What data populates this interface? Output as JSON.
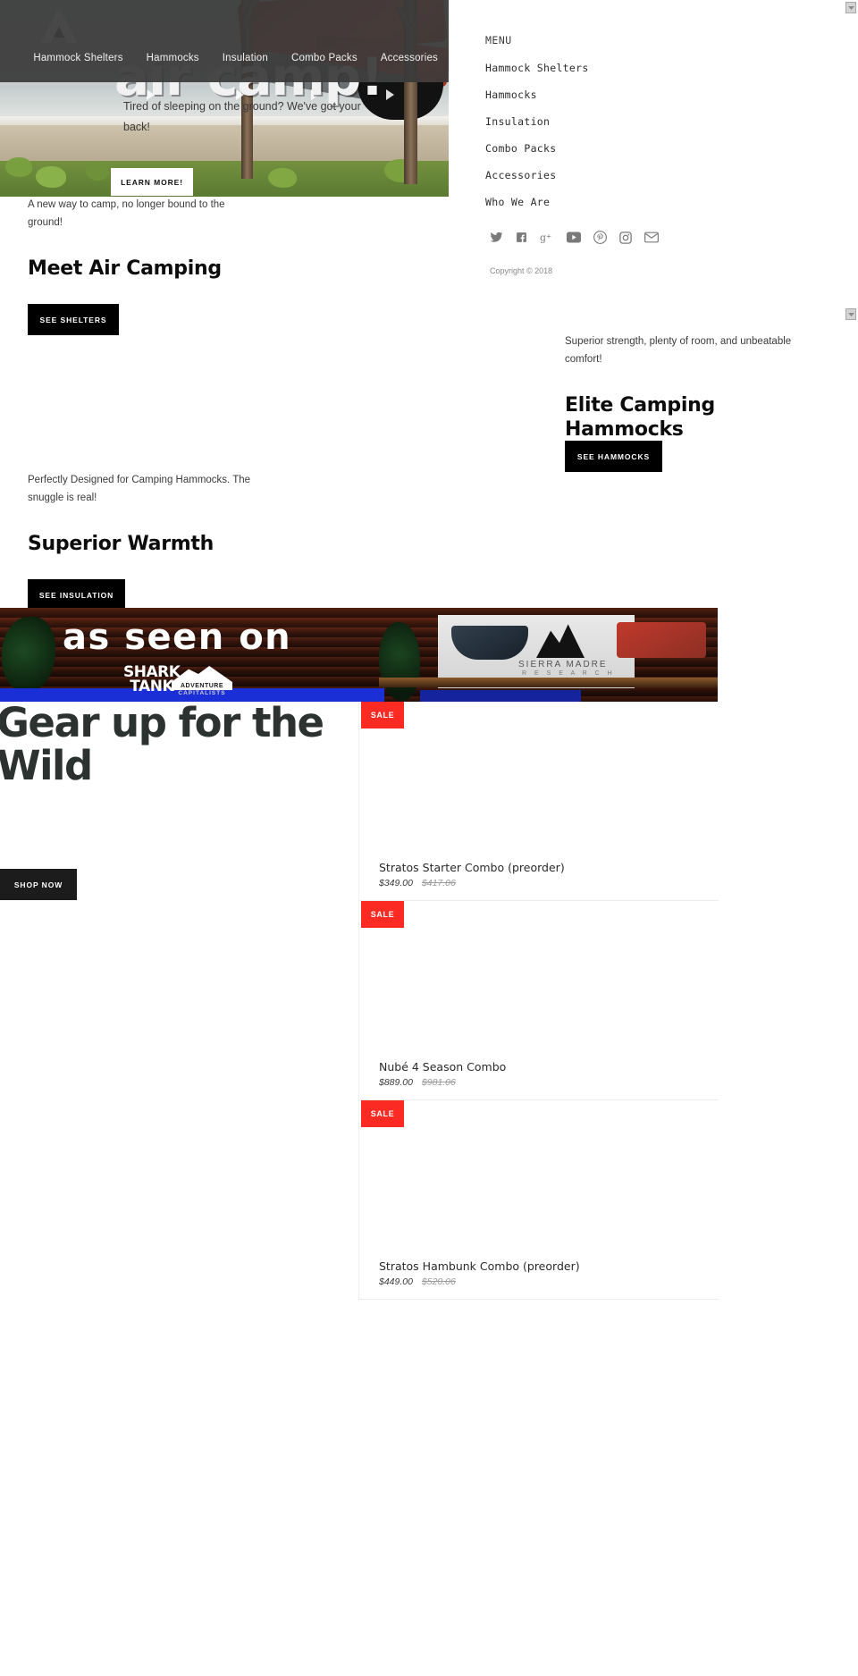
{
  "site": {
    "logo_icon": "mountain-logo-icon",
    "nav": [
      {
        "label": "Hammock Shelters"
      },
      {
        "label": "Hammocks"
      },
      {
        "label": "Insulation"
      },
      {
        "label": "Combo Packs"
      },
      {
        "label": "Accessories"
      }
    ]
  },
  "hero": {
    "title": "air camp!",
    "subtitle": "Tired of sleeping on the ground? We've got your back!",
    "cta": "LEARN MORE!"
  },
  "menu": {
    "heading": "MENU",
    "items": [
      {
        "label": "Hammock Shelters"
      },
      {
        "label": "Hammocks"
      },
      {
        "label": "Insulation"
      },
      {
        "label": "Combo Packs"
      },
      {
        "label": "Accessories"
      },
      {
        "label": "Who We Are"
      }
    ],
    "socials": [
      {
        "name": "twitter-icon"
      },
      {
        "name": "facebook-icon"
      },
      {
        "name": "google-plus-icon"
      },
      {
        "name": "youtube-icon"
      },
      {
        "name": "pinterest-icon"
      },
      {
        "name": "instagram-icon"
      },
      {
        "name": "email-icon"
      }
    ],
    "copyright": "Copyright © 2018"
  },
  "blocks": [
    {
      "blurb": "A new way to camp, no longer bound to the ground!",
      "title": "Meet Air Camping",
      "cta": "SEE SHELTERS"
    },
    {
      "blurb": "Superior strength, plenty of room, and unbeatable comfort!",
      "title": "Elite Camping Hammocks",
      "cta": "SEE HAMMOCKS"
    },
    {
      "blurb": "Perfectly Designed for Camping Hammocks. The snuggle is real!",
      "title": "Superior Warmth",
      "cta": "SEE INSULATION"
    }
  ],
  "banner": {
    "title": "as seen on",
    "shark_line1": "SHARK",
    "shark_line2": "TANK",
    "badge_line1": "ADVENTURE",
    "badge_line2": "CAPITALISTS",
    "sign_line1": "SIERRA MADRE",
    "sign_line2": "R E S E A R C H"
  },
  "gear": {
    "title": "Gear up for the Wild",
    "cta": "SHOP NOW"
  },
  "products": [
    {
      "badge": "SALE",
      "name": "Stratos Starter Combo (preorder)",
      "price": "$349.00",
      "old_price": "$417.06"
    },
    {
      "badge": "SALE",
      "name": "Nubé 4 Season Combo",
      "price": "$889.00",
      "old_price": "$981.06"
    },
    {
      "badge": "SALE",
      "name": "Stratos Hambunk Combo (preorder)",
      "price": "$449.00",
      "old_price": "$520.06"
    }
  ],
  "colors": {
    "sale_red": "#fb2a23",
    "button_black": "#000000",
    "topbar": "#3a3a3a"
  }
}
